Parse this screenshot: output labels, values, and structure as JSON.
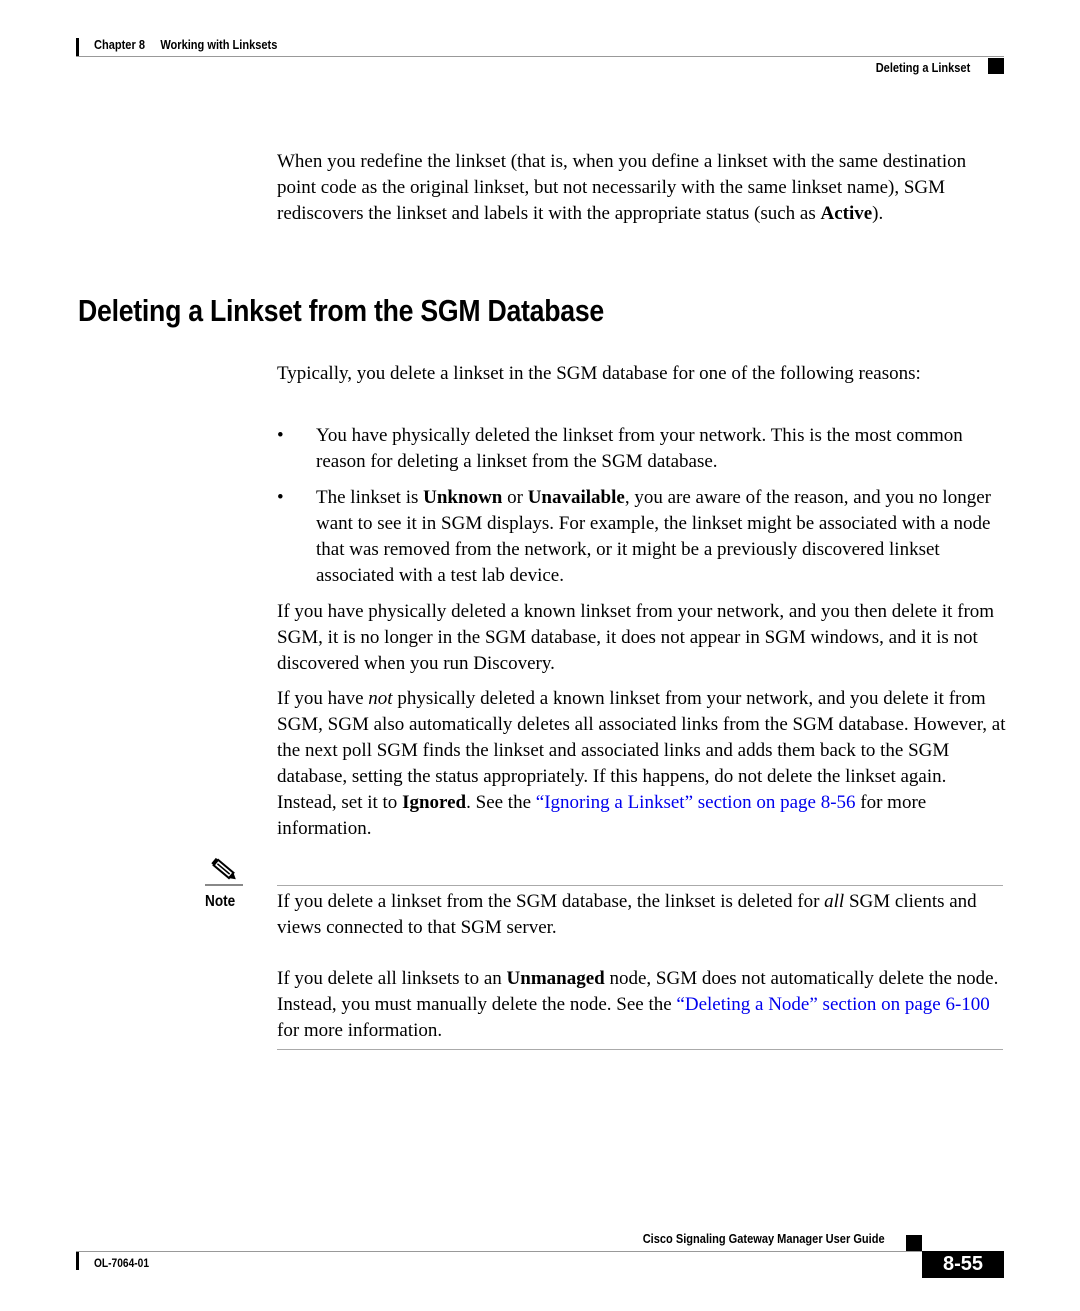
{
  "header": {
    "chapter": "Chapter 8     Working with Linksets",
    "section": "Deleting a Linkset"
  },
  "intro": {
    "parts": [
      "When you redefine the linkset (that is, when you define a linkset with the same destination point code as the original linkset, but not necessarily with the same linkset name), SGM rediscovers the linkset and labels it with the appropriate status (such as ",
      "Active",
      ")."
    ]
  },
  "heading": "Deleting a Linkset from the SGM Database",
  "para1": "Typically, you delete a linkset in the SGM database for one of the following reasons:",
  "bullets": [
    {
      "parts": [
        "You have physically deleted the linkset from your network. This is the most common reason for deleting a linkset from the SGM database."
      ]
    },
    {
      "parts": [
        "The linkset is ",
        "Unknown",
        " or ",
        "Unavailable",
        ", you are aware of the reason, and you no longer want to see it in SGM displays. For example, the linkset might be associated with a node that was removed from the network, or it might be a previously discovered linkset associated with a test lab device."
      ]
    }
  ],
  "para2": "If you have physically deleted a known linkset from your network, and you then delete it from SGM, it is no longer in the SGM database, it does not appear in SGM windows, and it is not discovered when you run Discovery.",
  "para3": {
    "p1": "If you have ",
    "em": "not",
    "p2": " physically deleted a known linkset from your network, and you delete it from SGM, SGM also automatically deletes all associated links from the SGM database. However, at the next poll SGM finds the linkset and associated links and adds them back to the SGM database, setting the status appropriately. If this happens, do not delete the linkset again. Instead, set it to ",
    "bold": "Ignored",
    "p3": ". See the ",
    "link": "“Ignoring a Linkset” section on page 8-56",
    "p4": " for more information."
  },
  "note": {
    "label": "Note",
    "p1": "If you delete a linkset from the SGM database, the linkset is deleted for ",
    "em": "all",
    "p2": " SGM clients and views connected to that SGM server.",
    "q1": "If you delete all linksets to an ",
    "bold": "Unmanaged",
    "q2": " node, SGM does not automatically delete the node. Instead, you must manually delete the node. See the ",
    "link": "“Deleting a Node” section on page 6-100",
    "q3": " for more information."
  },
  "footer": {
    "title": "Cisco Signaling Gateway Manager User Guide",
    "doc_number": "OL-7064-01",
    "page": "8-55"
  }
}
